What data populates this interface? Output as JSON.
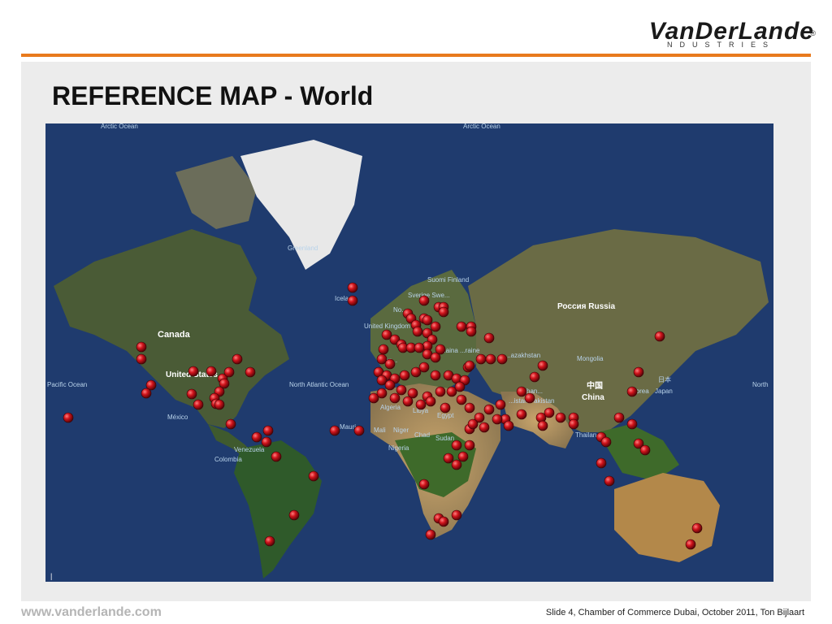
{
  "header": {
    "logo_text": "VanDerLande",
    "logo_subtext": "NDUSTRIES",
    "logo_registered": "®"
  },
  "title": "REFERENCE MAP - World",
  "map": {
    "labels": {
      "arctic_left": "Arctic Ocean",
      "arctic_right": "Arctic Ocean",
      "greenland": "Greenland",
      "iceland": "Icela...",
      "canada": "Canada",
      "united_states": "United States",
      "mexico": "México",
      "venezuela": "Venezuela",
      "colombia": "Colombia",
      "pacific_left": "Pacific Ocean",
      "pacific_right": "North",
      "north_atlantic": "North Atlantic Ocean",
      "suomi": "Suomi Finland",
      "sverige": "Sverige Swe...",
      "norway": "No...",
      "united_kingdom": "United Kingdom",
      "france": "Fran...",
      "ukraine": "...aina ...raine",
      "kazakhstan": "...azakhstan",
      "russia": "Россия Russia",
      "mongolia": "Mongolia",
      "china_zh": "中国",
      "china": "China",
      "japan_zh": "日本",
      "korea": "...orea",
      "japan": "Japan",
      "pakistan": "...istan Pakistan",
      "afghanistan": "Afghan...",
      "algeria": "Algeria",
      "libya": "Libya",
      "egypt": "Egypt",
      "mauritania": "Mauri...",
      "mali": "Mali",
      "niger": "Niger",
      "chad": "Chad",
      "sudan": "Sudan",
      "nigeria": "Nigeria",
      "thailand": "Thailan..."
    },
    "copyright": "|"
  },
  "footer": {
    "url": "www.vanderlande.com",
    "slide_info": "Slide 4, Chamber of Commerce Dubai, October 2011, Ton Bijlaart"
  },
  "colors": {
    "accent": "#e87a1d",
    "ocean": "#1f3b6e",
    "marker": "#c4121a"
  },
  "markers_count": 140
}
